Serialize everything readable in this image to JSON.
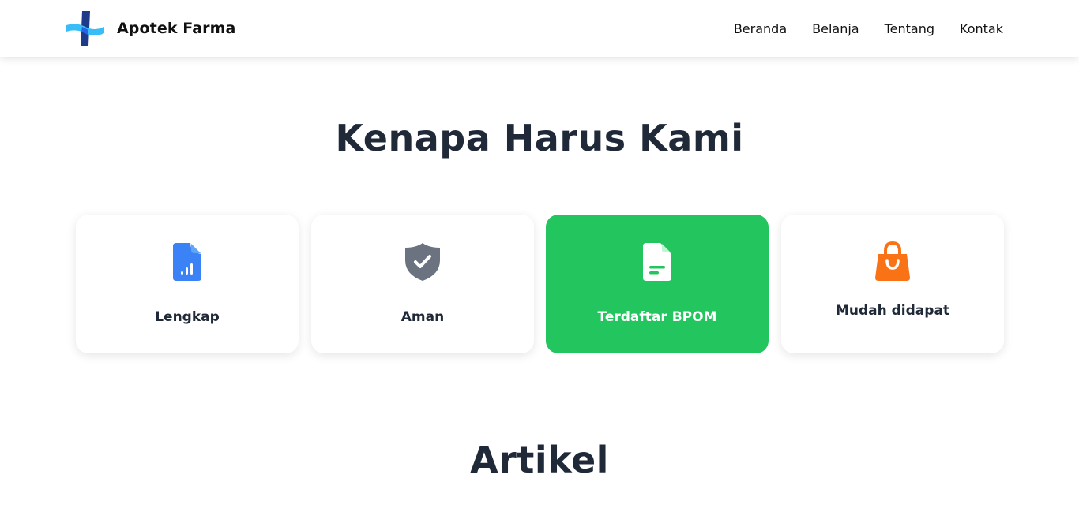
{
  "navbar": {
    "brand_name": "Apotek Farma",
    "logo_icon": "cross-logo-icon",
    "links": [
      {
        "label": "Beranda"
      },
      {
        "label": "Belanja"
      },
      {
        "label": "Tentang"
      },
      {
        "label": "Kontak"
      }
    ]
  },
  "why_section": {
    "title": "Kenapa Harus Kami",
    "cards": [
      {
        "label": "Lengkap",
        "icon": "document-chart-icon",
        "icon_color": "#3b82f6",
        "active": false
      },
      {
        "label": "Aman",
        "icon": "shield-check-icon",
        "icon_color": "#6b7280",
        "active": false
      },
      {
        "label": "Terdaftar BPOM",
        "icon": "document-text-icon",
        "icon_color": "#ffffff",
        "active": true
      },
      {
        "label": "Mudah didapat",
        "icon": "shopping-bag-icon",
        "icon_color": "#f97316",
        "active": false
      }
    ]
  },
  "articles_section": {
    "title": "Artikel"
  },
  "colors": {
    "accent_green": "#22c55e",
    "logo_light_blue": "#38bdf8",
    "logo_dark_blue": "#1e3a8a",
    "heading": "#1f2937"
  }
}
